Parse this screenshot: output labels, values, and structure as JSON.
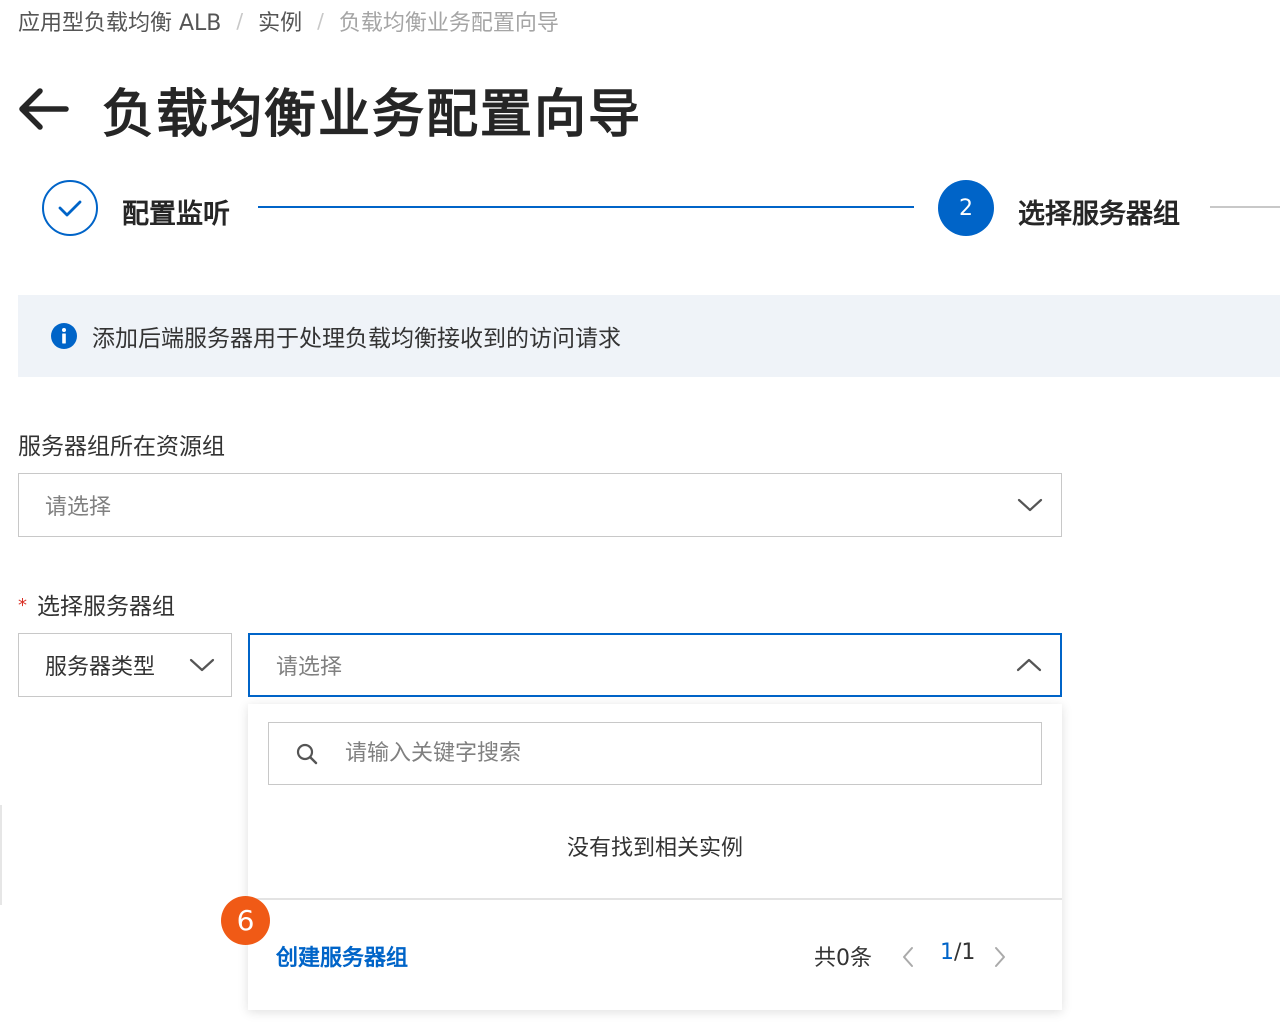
{
  "breadcrumb": {
    "items": [
      "应用型负载均衡 ALB",
      "实例",
      "负载均衡业务配置向导"
    ],
    "separator": "/"
  },
  "page": {
    "title": "负载均衡业务配置向导",
    "back_icon": "arrow-left-icon"
  },
  "steps": [
    {
      "label": "配置监听",
      "status": "done",
      "icon": "check-icon"
    },
    {
      "number": "2",
      "label": "选择服务器组",
      "status": "active"
    }
  ],
  "notice": {
    "icon": "info-icon",
    "text": "添加后端服务器用于处理负载均衡接收到的访问请求"
  },
  "form": {
    "resource_group": {
      "label": "服务器组所在资源组",
      "placeholder": "请选择"
    },
    "server_group": {
      "required_mark": "*",
      "label": "选择服务器组",
      "type_value": "服务器类型",
      "placeholder": "请选择"
    }
  },
  "dropdown": {
    "search_placeholder": "请输入关键字搜索",
    "empty_text": "没有找到相关实例",
    "create_link": "创建服务器组",
    "total": "共0条",
    "page_current": "1",
    "page_total": "/1"
  },
  "annotation": {
    "badge": "6"
  },
  "colors": {
    "primary": "#0064c8",
    "badge": "#f05a16",
    "notice_bg": "#eff3f8",
    "required": "#d93026"
  }
}
